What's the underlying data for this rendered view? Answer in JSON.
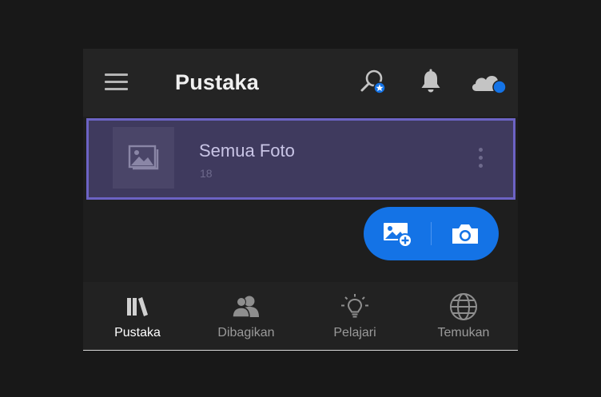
{
  "header": {
    "title": "Pustaka",
    "icons": [
      "menu-icon",
      "search-star-icon",
      "bell-icon",
      "cloud-icon"
    ]
  },
  "album": {
    "name": "Semua Foto",
    "count": "18"
  },
  "fab": {
    "icons": [
      "add-photo-icon",
      "camera-icon"
    ]
  },
  "tabs": [
    {
      "label": "Pustaka",
      "icon": "library-icon",
      "active": true
    },
    {
      "label": "Dibagikan",
      "icon": "people-icon",
      "active": false
    },
    {
      "label": "Pelajari",
      "icon": "lightbulb-icon",
      "active": false
    },
    {
      "label": "Temukan",
      "icon": "globe-icon",
      "active": false
    }
  ],
  "colors": {
    "accent": "#1473e6",
    "selection_border": "#6c63c4",
    "selection_bg": "#3f3a5e",
    "cloud_badge": "#1473e6"
  }
}
